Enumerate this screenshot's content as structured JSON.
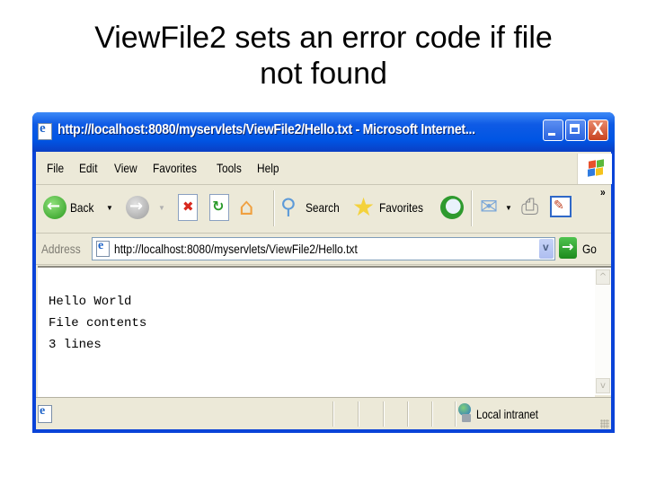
{
  "slide": {
    "title_line1": "ViewFile2 sets an error code if file",
    "title_line2": "not found"
  },
  "window": {
    "title": "http://localhost:8080/myservlets/ViewFile2/Hello.txt - Microsoft Internet...",
    "controls": {
      "minimize": "minimize",
      "maximize": "maximize",
      "close": "close"
    }
  },
  "menubar": {
    "items": [
      "File",
      "Edit",
      "View",
      "Favorites",
      "Tools",
      "Help"
    ]
  },
  "toolbar": {
    "back_label": "Back",
    "search_label": "Search",
    "favorites_label": "Favorites",
    "more": "»",
    "icons": [
      "back-icon",
      "forward-icon",
      "stop-icon",
      "refresh-icon",
      "home-icon",
      "search-icon",
      "favorites-star-icon",
      "history-icon",
      "mail-icon",
      "print-icon",
      "edit-icon"
    ]
  },
  "addressbar": {
    "label": "Address",
    "url": "http://localhost:8080/myservlets/ViewFile2/Hello.txt",
    "go_label": "Go"
  },
  "content": {
    "lines": [
      "Hello World",
      "File contents",
      "3 lines"
    ]
  },
  "statusbar": {
    "status_text": "",
    "zone": "Local intranet"
  },
  "colors": {
    "titlebar": "#0055e4",
    "chrome": "#ece9d8",
    "close_button": "#c8421f"
  }
}
